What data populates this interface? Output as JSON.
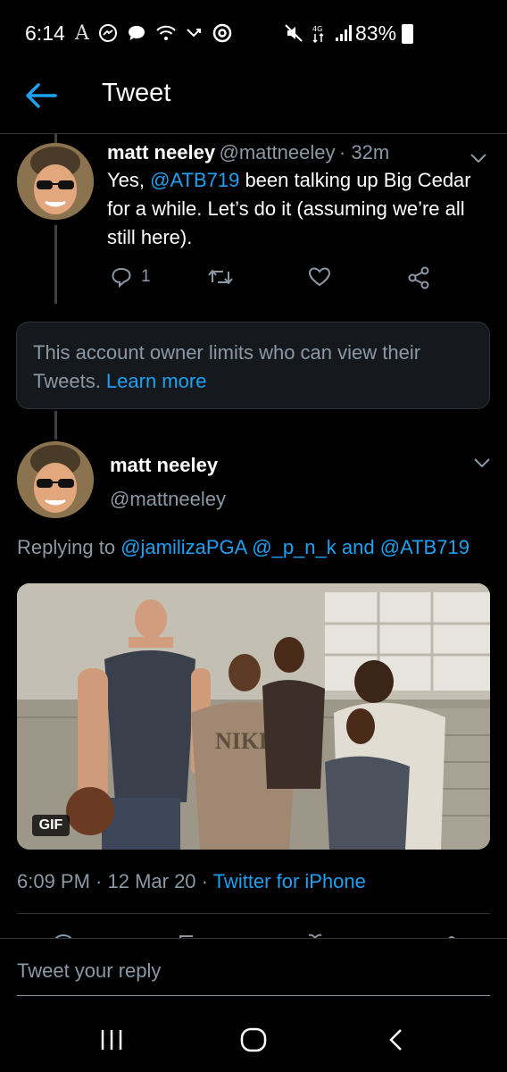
{
  "status_bar": {
    "time": "6:14",
    "battery": "83%",
    "left_icons": [
      "a-icon",
      "messenger-icon",
      "chat-icon",
      "wifi-icon",
      "missed-call-icon",
      "spiral-icon"
    ],
    "right_icons": [
      "mute-icon",
      "lte-icon",
      "signal-icon",
      "battery-icon"
    ]
  },
  "header": {
    "title": "Tweet"
  },
  "parent_tweet": {
    "name": "matt neeley",
    "handle": "@mattneeley",
    "time": "· 32m",
    "text_part1": "Yes, ",
    "mention": "@ATB719",
    "text_part2": " been talking up Big Cedar for a while. Let’s do it (assuming we’re all still here).",
    "reply_count": "1"
  },
  "notice": {
    "text": "This account owner limits who can view their Tweets. ",
    "link": "Learn more"
  },
  "main_tweet": {
    "name": "matt neeley",
    "handle": "@mattneeley",
    "replying_prefix": "Replying to ",
    "mention1": "@jamilizaPGA",
    "mention2": "@_p_n_k",
    "and": "and",
    "mention3": "@ATB719",
    "gif_badge": "GIF",
    "timestamp": "6:09 PM · 12 Mar 20 · ",
    "source": "Twitter for iPhone"
  },
  "reply": {
    "placeholder": "Tweet your reply"
  },
  "colors": {
    "accent": "#1da1f2",
    "muted": "#8b98a5",
    "background": "#000000",
    "card": "#15181c"
  }
}
